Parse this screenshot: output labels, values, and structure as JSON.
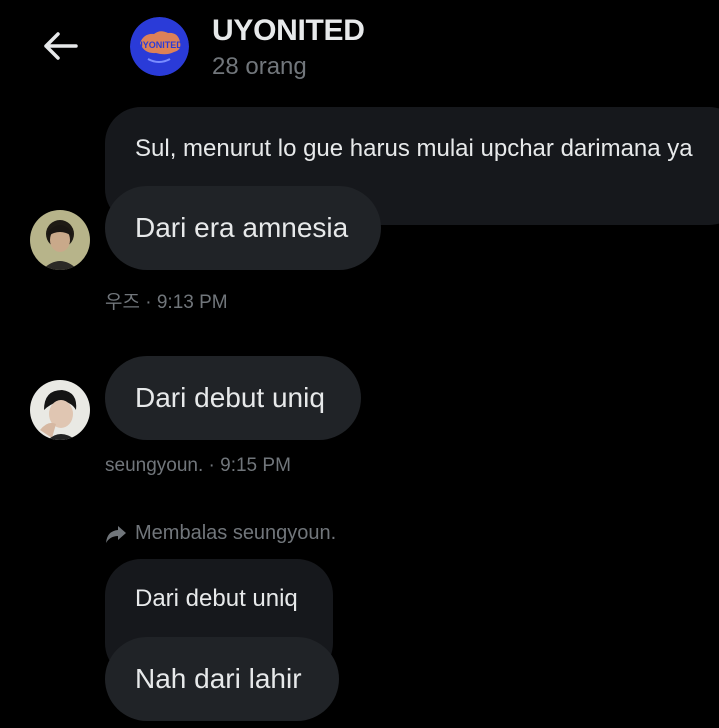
{
  "header": {
    "back_icon": "arrow-left-icon",
    "group_name": "UYONITED",
    "member_count": "28 orang",
    "avatar_text": "UYONITED"
  },
  "messages": [
    {
      "quoted_text": "Sul, menurut lo gue harus mulai upchar darimana ya",
      "text": "Dari era amnesia",
      "sender": "우즈",
      "time": "9:13 PM",
      "meta": "우즈 · 9:13 PM"
    },
    {
      "text": "Dari debut uniq",
      "sender": "seungyoun.",
      "time": "9:15 PM",
      "meta": "seungyoun. · 9:15 PM"
    },
    {
      "reply_label": "Membalas seungyoun.",
      "quoted_text": "Dari debut uniq",
      "text": "Nah dari lahir"
    }
  ],
  "colors": {
    "background": "#000000",
    "bubble": "#202327",
    "quoted_bubble": "#16181c",
    "primary_text": "#e7e9ea",
    "secondary_text": "#71767b",
    "group_avatar": "#2a3bd8"
  }
}
